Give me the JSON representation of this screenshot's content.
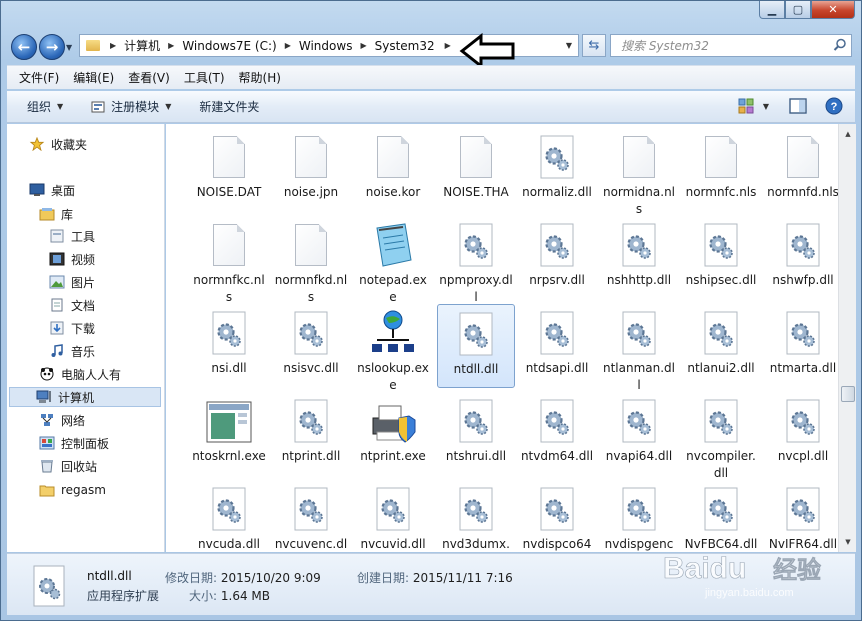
{
  "address": {
    "crumbs": [
      "计算机",
      "Windows7E (C:)",
      "Windows",
      "System32"
    ]
  },
  "search": {
    "placeholder": "搜索 System32"
  },
  "menu": [
    "文件(F)",
    "编辑(E)",
    "查看(V)",
    "工具(T)",
    "帮助(H)"
  ],
  "toolbar": {
    "organize": "组织",
    "register": "注册模块",
    "new_folder": "新建文件夹"
  },
  "nav": {
    "favorites": "收藏夹",
    "desktop": "桌面",
    "libraries": "库",
    "tools": "工具",
    "videos": "视频",
    "pictures": "图片",
    "documents": "文档",
    "downloads": "下载",
    "music": "音乐",
    "pcrenren": "电脑人人有",
    "computer": "计算机",
    "network": "网络",
    "control_panel": "控制面板",
    "recycle_bin": "回收站",
    "regasm": "regasm"
  },
  "files": [
    {
      "name": "NOISE.DAT",
      "icon": "blank"
    },
    {
      "name": "noise.jpn",
      "icon": "blank"
    },
    {
      "name": "noise.kor",
      "icon": "blank"
    },
    {
      "name": "NOISE.THA",
      "icon": "blank"
    },
    {
      "name": "normaliz.dll",
      "icon": "dll"
    },
    {
      "name": "normidna.nls",
      "icon": "blank"
    },
    {
      "name": "normnfc.nls",
      "icon": "blank"
    },
    {
      "name": "normnfd.nls",
      "icon": "blank"
    },
    {
      "name": "normnfkc.nls",
      "icon": "blank"
    },
    {
      "name": "normnfkd.nls",
      "icon": "blank"
    },
    {
      "name": "notepad.exe",
      "icon": "notepad"
    },
    {
      "name": "npmproxy.dll",
      "icon": "dll"
    },
    {
      "name": "nrpsrv.dll",
      "icon": "dll"
    },
    {
      "name": "nshhttp.dll",
      "icon": "dll"
    },
    {
      "name": "nshipsec.dll",
      "icon": "dll"
    },
    {
      "name": "nshwfp.dll",
      "icon": "dll"
    },
    {
      "name": "nsi.dll",
      "icon": "dll"
    },
    {
      "name": "nsisvc.dll",
      "icon": "dll"
    },
    {
      "name": "nslookup.exe",
      "icon": "network"
    },
    {
      "name": "ntdll.dll",
      "icon": "dll",
      "selected": true
    },
    {
      "name": "ntdsapi.dll",
      "icon": "dll"
    },
    {
      "name": "ntlanman.dll",
      "icon": "dll"
    },
    {
      "name": "ntlanui2.dll",
      "icon": "dll"
    },
    {
      "name": "ntmarta.dll",
      "icon": "dll"
    },
    {
      "name": "ntoskrnl.exe",
      "icon": "window"
    },
    {
      "name": "ntprint.dll",
      "icon": "dll"
    },
    {
      "name": "ntprint.exe",
      "icon": "printer"
    },
    {
      "name": "ntshrui.dll",
      "icon": "dll"
    },
    {
      "name": "ntvdm64.dll",
      "icon": "dll"
    },
    {
      "name": "nvapi64.dll",
      "icon": "dll"
    },
    {
      "name": "nvcompiler.dll",
      "icon": "dll"
    },
    {
      "name": "nvcpl.dll",
      "icon": "dll"
    },
    {
      "name": "nvcuda.dll",
      "icon": "dll"
    },
    {
      "name": "nvcuvenc.dll",
      "icon": "dll"
    },
    {
      "name": "nvcuvid.dll",
      "icon": "dll"
    },
    {
      "name": "nvd3dumx.dll",
      "icon": "dll"
    },
    {
      "name": "nvdispco6433285.dll",
      "icon": "dll"
    },
    {
      "name": "nvdispgenco643328",
      "icon": "dll"
    },
    {
      "name": "NvFBC64.dll",
      "icon": "dll"
    },
    {
      "name": "NvIFR64.dll",
      "icon": "dll"
    }
  ],
  "details": {
    "name": "ntdll.dll",
    "type": "应用程序扩展",
    "modified_label": "修改日期:",
    "modified": "2015/10/20 9:09",
    "created_label": "创建日期:",
    "created": "2015/11/11 7:16",
    "size_label": "大小:",
    "size": "1.64 MB"
  },
  "watermark": {
    "brand": "Baidu",
    "cn": "经验",
    "url": "jingyan.baidu.com"
  },
  "colors": {
    "selection": "#d3e5fb",
    "accent": "#2b67b8"
  }
}
